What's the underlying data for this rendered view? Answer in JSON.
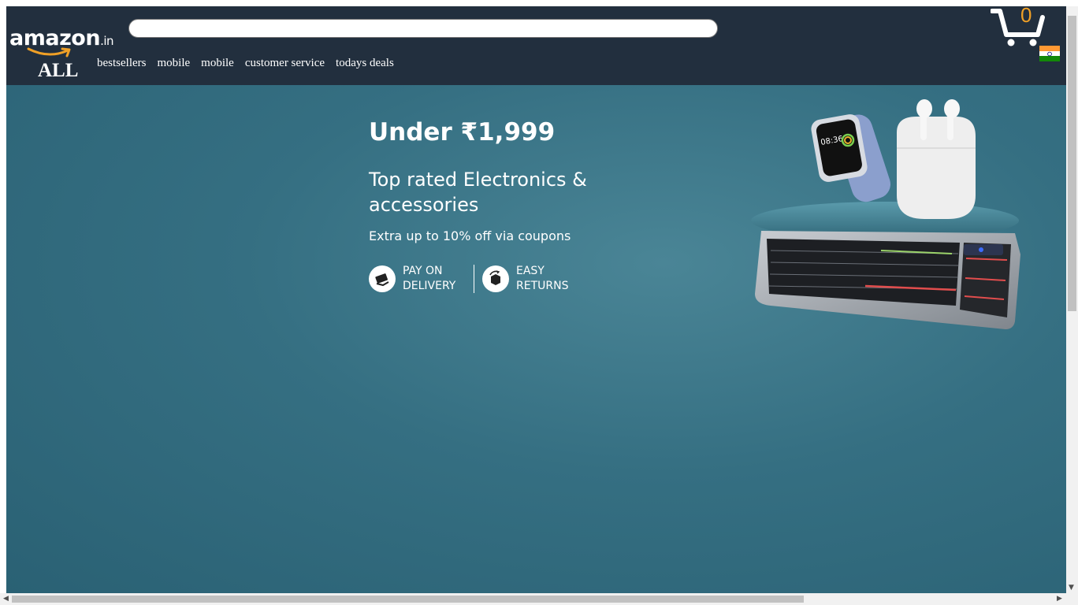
{
  "header": {
    "logo": {
      "text": "amazon",
      "tld": ".in"
    },
    "all_label": "ALL",
    "search": {
      "value": "",
      "placeholder": ""
    },
    "nav": [
      "bestsellers",
      "mobile",
      "mobile",
      "customer service",
      "todays deals"
    ],
    "cart_count": "0",
    "flag": {
      "colors": [
        "#ff9933",
        "#ffffff",
        "#138808"
      ]
    }
  },
  "hero": {
    "price": "Under ₹1,999",
    "title": "Top rated Electronics & accessories",
    "subtitle": "Extra up to 10% off via coupons",
    "badges": [
      {
        "icon": "pay-on-delivery-icon",
        "label": "PAY ON DELIVERY"
      },
      {
        "icon": "easy-returns-icon",
        "label": "EASY RETURNS"
      }
    ],
    "products": [
      "smartwatch",
      "earbuds-case",
      "backlit-keyboard"
    ],
    "watch_time": "08:36",
    "background_color": "#2f6a7c"
  }
}
